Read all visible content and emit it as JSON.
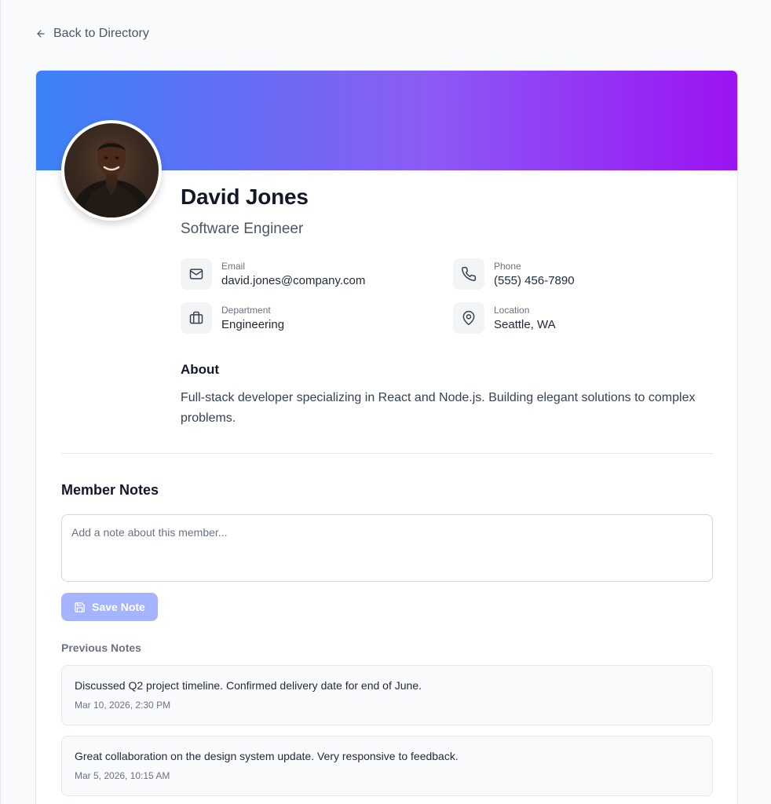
{
  "nav": {
    "back_label": "Back to Directory"
  },
  "profile": {
    "name": "David Jones",
    "title": "Software Engineer",
    "banner_colors": [
      "#3b82f6",
      "#8b5cf6",
      "#9b13f2"
    ]
  },
  "contact": {
    "email": {
      "label": "Email",
      "value": "david.jones@company.com"
    },
    "phone": {
      "label": "Phone",
      "value": "(555) 456-7890"
    },
    "department": {
      "label": "Department",
      "value": "Engineering"
    },
    "location": {
      "label": "Location",
      "value": "Seattle, WA"
    }
  },
  "about": {
    "heading": "About",
    "text": "Full-stack developer specializing in React and Node.js. Building elegant solutions to complex problems."
  },
  "notes": {
    "heading": "Member Notes",
    "placeholder": "Add a note about this member...",
    "save_label": "Save Note",
    "previous_heading": "Previous Notes",
    "items": [
      {
        "text": "Discussed Q2 project timeline. Confirmed delivery date for end of June.",
        "date": "Mar 10, 2026, 2:30 PM"
      },
      {
        "text": "Great collaboration on the design system update. Very responsive to feedback.",
        "date": "Mar 5, 2026, 10:15 AM"
      }
    ]
  }
}
